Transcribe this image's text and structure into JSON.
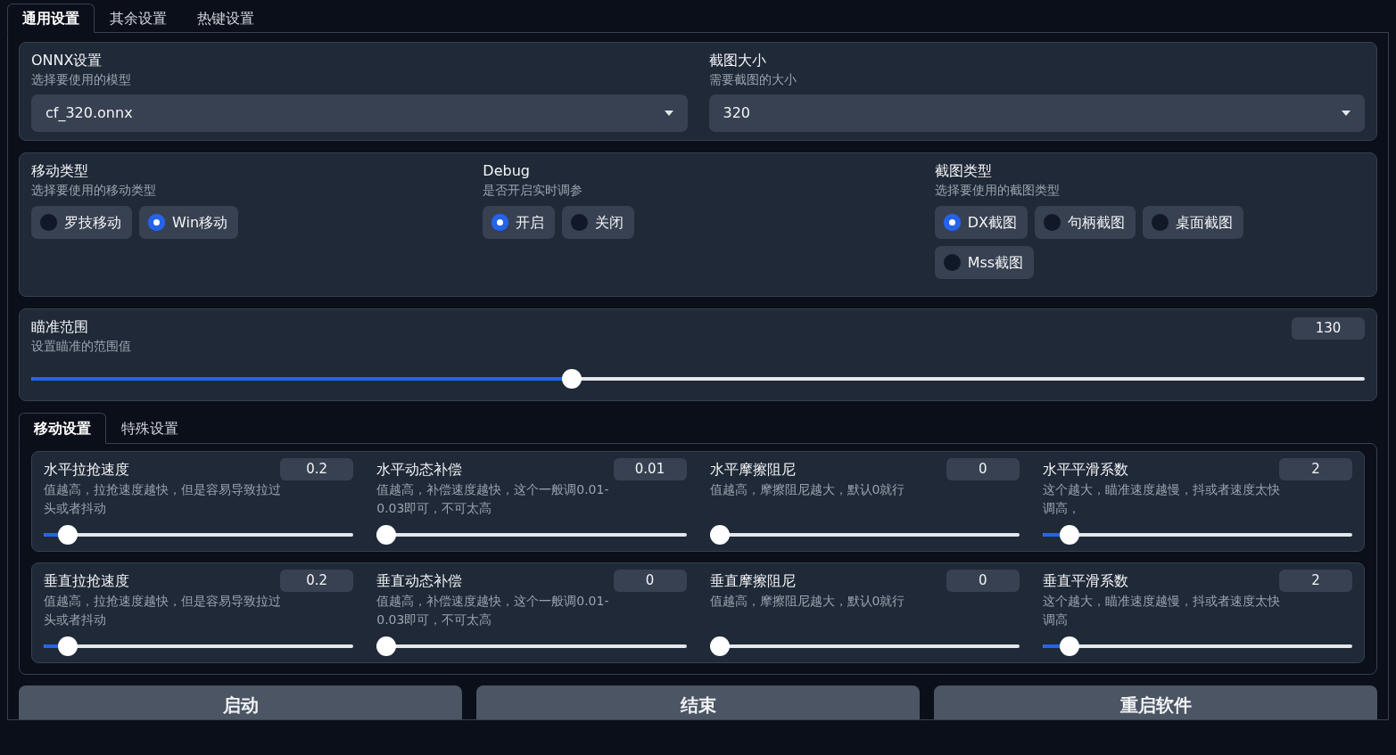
{
  "tabs": [
    {
      "label": "通用设置",
      "selected": true
    },
    {
      "label": "其余设置",
      "selected": false
    },
    {
      "label": "热键设置",
      "selected": false
    }
  ],
  "selects": [
    {
      "title": "ONNX设置",
      "hint": "选择要使用的模型",
      "value": "cf_320.onnx"
    },
    {
      "title": "截图大小",
      "hint": "需要截图的大小",
      "value": "320"
    }
  ],
  "radio_groups": [
    {
      "title": "移动类型",
      "hint": "选择要使用的移动类型",
      "options": [
        {
          "label": "罗技移动",
          "selected": false
        },
        {
          "label": "Win移动",
          "selected": true
        }
      ]
    },
    {
      "title": "Debug",
      "hint": "是否开启实时调参",
      "options": [
        {
          "label": "开启",
          "selected": true
        },
        {
          "label": "关闭",
          "selected": false
        }
      ]
    },
    {
      "title": "截图类型",
      "hint": "选择要使用的截图类型",
      "options": [
        {
          "label": "DX截图",
          "selected": true
        },
        {
          "label": "句柄截图",
          "selected": false
        },
        {
          "label": "桌面截图",
          "selected": false
        },
        {
          "label": "Mss截图",
          "selected": false
        }
      ]
    }
  ],
  "aim_range": {
    "title": "瞄准范围",
    "hint": "设置瞄准的范围值",
    "value": "130",
    "level": 0.404
  },
  "sub_tabs": [
    {
      "label": "移动设置",
      "selected": true
    },
    {
      "label": "特殊设置",
      "selected": false
    }
  ],
  "sliders": [
    {
      "title": "水平拉抢速度",
      "hint": "值越高，拉抢速度越快，但是容易导致拉过头或者抖动",
      "value": "0.2",
      "level": 0.05
    },
    {
      "title": "水平动态补偿",
      "hint": "值越高，补偿速度越快，这个一般调0.01-0.03即可，不可太高",
      "value": "0.01",
      "level": 0
    },
    {
      "title": "水平摩擦阻尼",
      "hint": "值越高，摩擦阻尼越大，默认0就行",
      "value": "0",
      "level": 0
    },
    {
      "title": "水平平滑系数",
      "hint": "这个越大，瞄准速度越慢，抖或者速度太快调高，",
      "value": "2",
      "level": 0.06
    },
    {
      "title": "垂直拉抢速度",
      "hint": "值越高，拉抢速度越快，但是容易导致拉过头或者抖动",
      "value": "0.2",
      "level": 0.05
    },
    {
      "title": "垂直动态补偿",
      "hint": "值越高，补偿速度越快，这个一般调0.01-0.03即可，不可太高",
      "value": "0",
      "level": 0
    },
    {
      "title": "垂直摩擦阻尼",
      "hint": "值越高，摩擦阻尼越大，默认0就行",
      "value": "0",
      "level": 0
    },
    {
      "title": "垂直平滑系数",
      "hint": "这个越大，瞄准速度越慢，抖或者速度太快调高",
      "value": "2",
      "level": 0.06
    }
  ],
  "buttons": [
    "启动",
    "结束",
    "重启软件"
  ]
}
